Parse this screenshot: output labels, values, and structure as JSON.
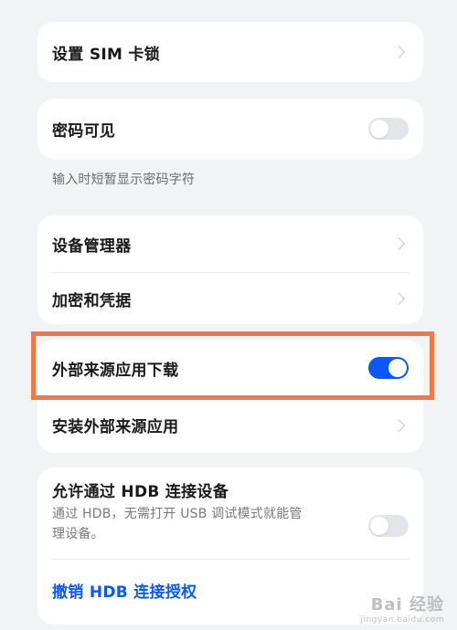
{
  "settings": {
    "sim_lock": {
      "label": "设置 SIM 卡锁"
    },
    "password_visible": {
      "label": "密码可见",
      "enabled": false,
      "hint": "输入时短暂显示密码字符"
    },
    "device_manager": {
      "label": "设备管理器"
    },
    "encryption": {
      "label": "加密和凭据"
    },
    "external_download": {
      "label": "外部来源应用下载",
      "enabled": true
    },
    "install_external": {
      "label": "安装外部来源应用"
    },
    "hdb": {
      "label": "允许通过 HDB 连接设备",
      "description_line1": "通过 HDB，无需打开 USB 调试模式就能管",
      "description_line2": "理设备。",
      "enabled": false,
      "revoke_label": "撤销 HDB 连接授权"
    }
  },
  "colors": {
    "accent": "#0a59f7",
    "highlight_border": "#ef7848",
    "background": "#f1f3f5"
  },
  "watermark": {
    "title": "Bai 经验",
    "url": "jingyan.baidu.com"
  }
}
